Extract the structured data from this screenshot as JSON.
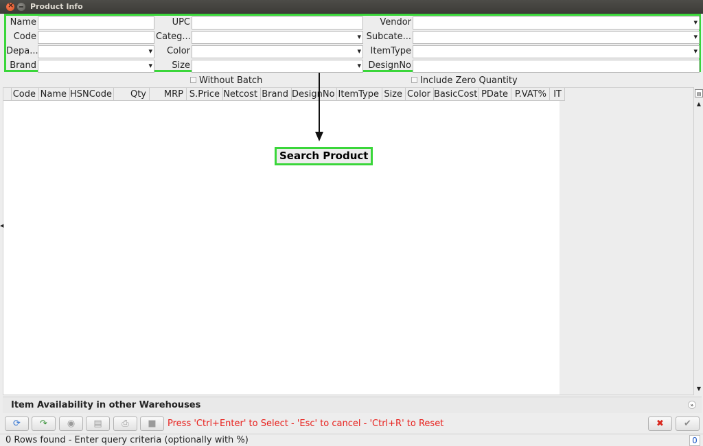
{
  "window": {
    "title": "Product Info"
  },
  "criteria": {
    "name_label": "Name",
    "upc_label": "UPC",
    "vendor_label": "Vendor",
    "code_label": "Code",
    "category_label": "Categ...",
    "subcategory_label": "Subcate...",
    "department_label": "Depa...",
    "color_label": "Color",
    "itemtype_label": "ItemType",
    "brand_label": "Brand",
    "size_label": "Size",
    "designno_label": "DesignNo"
  },
  "options": {
    "without_batch": "Without Batch",
    "include_zero_quantity": "Include Zero Quantity"
  },
  "table": {
    "columns": [
      "Code",
      "Name",
      "HSNCode",
      "Qty",
      "MRP",
      "S.Price",
      "Netcost",
      "Brand",
      "DesignNo",
      "ItemType",
      "Size",
      "Color",
      "BasicCost",
      "PDate",
      "P.VAT%",
      "IT"
    ]
  },
  "annotation": {
    "label": "Search Product"
  },
  "warehouses": {
    "title": "Item Availability in other Warehouses"
  },
  "toolbar": {
    "hint": "Press 'Ctrl+Enter' to Select - 'Esc' to cancel - 'Ctrl+R' to Reset"
  },
  "status": {
    "text": "0 Rows found - Enter query criteria (optionally with %)",
    "count": "0"
  },
  "colors": {
    "highlight": "#3ad63a",
    "hint_text": "#e8201c",
    "count_text": "#1a55c5"
  },
  "icons": [
    "close-icon",
    "minimize-icon",
    "refresh-icon",
    "redo-icon",
    "disc-icon",
    "find-icon",
    "print-icon",
    "clear-icon",
    "cancel-x-icon",
    "confirm-check-icon",
    "expand-icon",
    "scroll-up-icon",
    "scroll-down-icon"
  ]
}
